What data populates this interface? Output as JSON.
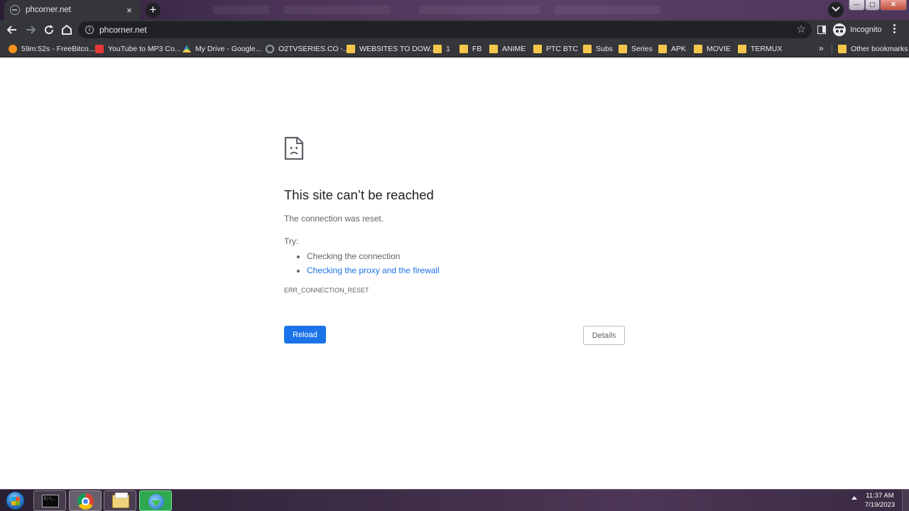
{
  "browser": {
    "tab": {
      "title": "phcorner.net",
      "close": "×"
    },
    "new_tab": "+",
    "url": "phcorner.net",
    "profile_label": "Incognito",
    "bookmarks": [
      {
        "label": "59m:52s - FreeBitco...",
        "icon": "bitcoin-icon"
      },
      {
        "label": "YouTube to MP3 Co...",
        "icon": "download-icon"
      },
      {
        "label": "My Drive - Google...",
        "icon": "google-drive-icon"
      },
      {
        "label": "O2TVSERIES.CO -...",
        "icon": "site-icon"
      },
      {
        "label": "WEBSITES TO DOW...",
        "icon": "folder-icon"
      },
      {
        "label": "1",
        "icon": "folder-icon"
      },
      {
        "label": "FB",
        "icon": "folder-icon"
      },
      {
        "label": "ANIME",
        "icon": "folder-icon"
      },
      {
        "label": "PTC BTC",
        "icon": "folder-icon"
      },
      {
        "label": "Subs",
        "icon": "folder-icon"
      },
      {
        "label": "Series",
        "icon": "folder-icon"
      },
      {
        "label": "APK",
        "icon": "folder-icon"
      },
      {
        "label": "MOVIE",
        "icon": "folder-icon"
      },
      {
        "label": "TERMUX",
        "icon": "folder-icon"
      }
    ],
    "bookmarks_overflow": "»",
    "other_bookmarks": "Other bookmarks"
  },
  "error": {
    "title": "This site can’t be reached",
    "description": "The connection was reset.",
    "try_label": "Try:",
    "suggestions": [
      {
        "text": "Checking the connection"
      },
      {
        "text": "Checking the proxy and the firewall"
      }
    ],
    "code": "ERR_CONNECTION_RESET",
    "reload_label": "Reload",
    "details_label": "Details"
  },
  "taskbar": {
    "apps": [
      "command-prompt",
      "google-chrome",
      "file-explorer",
      "internet-download-manager"
    ],
    "time": "11:37 AM",
    "date": "7/19/2023"
  },
  "colors": {
    "primary_blue": "#1a73e8",
    "browser_frame": "#35363a",
    "omnibox": "#202124"
  }
}
